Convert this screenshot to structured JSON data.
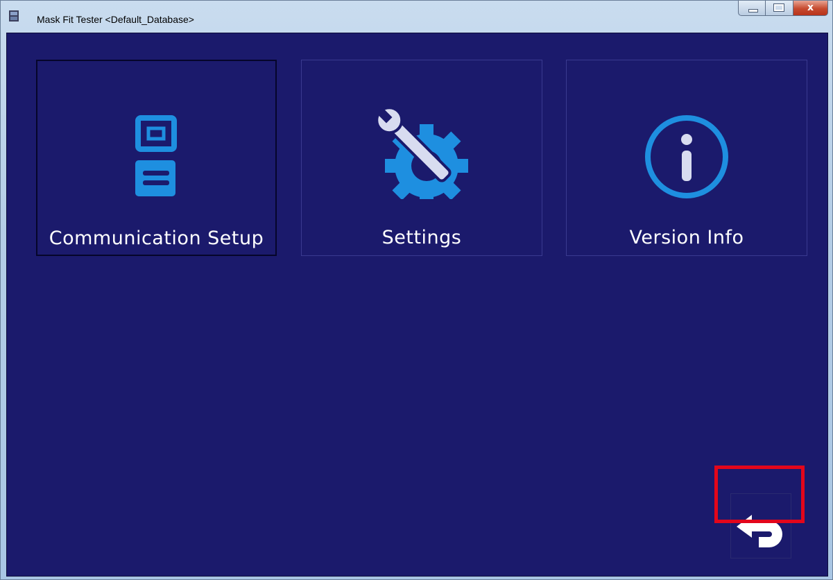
{
  "window": {
    "title": "Mask Fit Tester <Default_Database>",
    "close_glyph": "x"
  },
  "tiles": [
    {
      "label": "Communication Setup",
      "icon": "communication-device-icon",
      "selected": true
    },
    {
      "label": "Settings",
      "icon": "wrench-gear-icon",
      "selected": false
    },
    {
      "label": "Version Info",
      "icon": "info-icon",
      "selected": false
    }
  ],
  "back_button": {
    "icon": "back-arrow-icon",
    "highlighted": true
  },
  "colors": {
    "background": "#1b1a6c",
    "icon_blue": "#1e8fe0",
    "highlight_red": "#e3061b",
    "label_white": "#ffffff"
  }
}
